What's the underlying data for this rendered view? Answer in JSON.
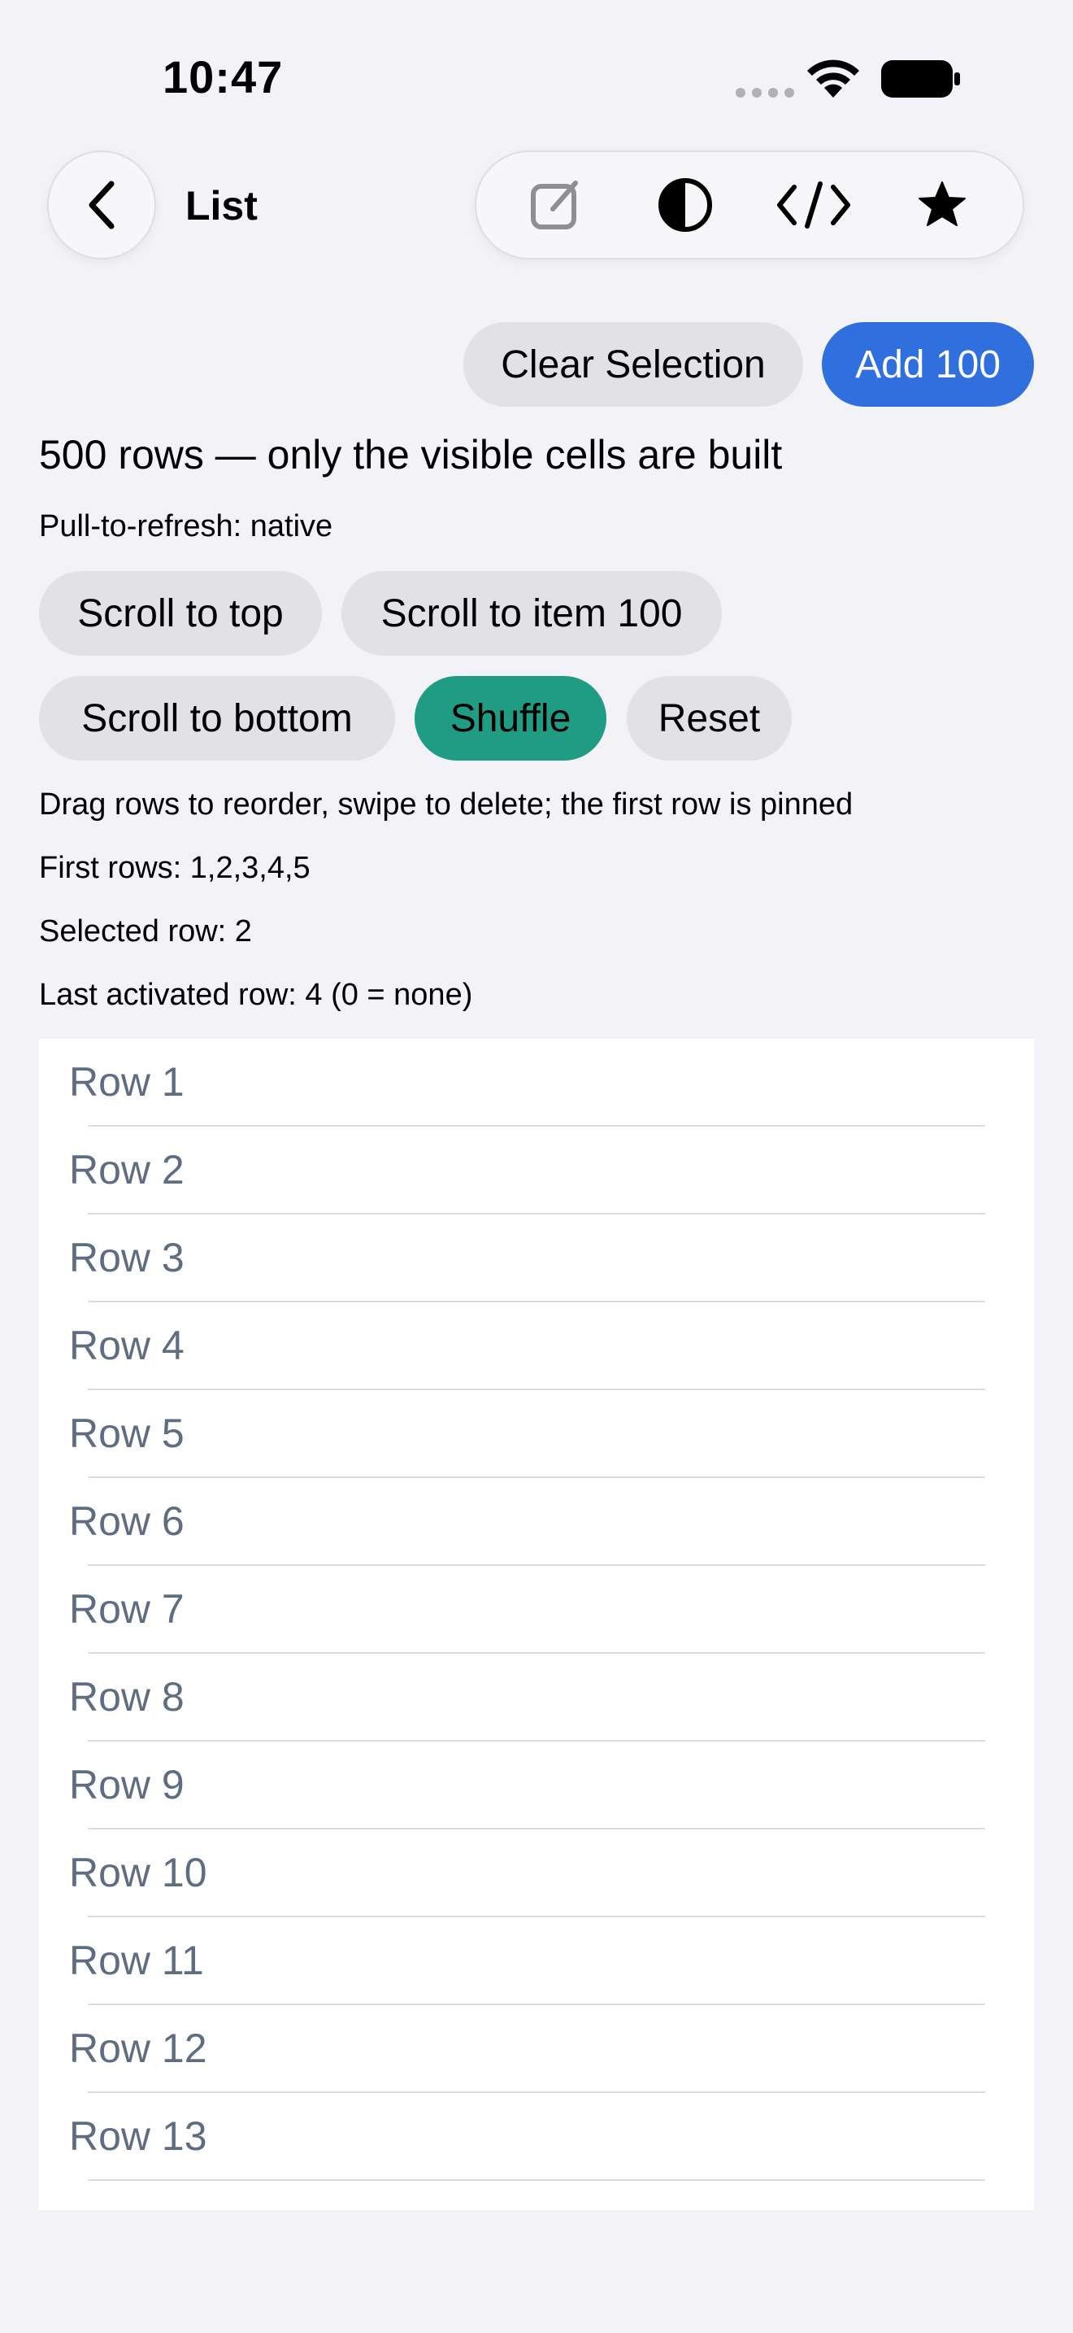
{
  "status": {
    "time": "10:47"
  },
  "nav": {
    "title": "List"
  },
  "toolbar": {
    "icons": [
      "compose-icon",
      "contrast-icon",
      "code-icon",
      "star-icon"
    ]
  },
  "actions": {
    "clear_selection": "Clear Selection",
    "add_100": "Add 100"
  },
  "info": {
    "heading": "500 rows — only the visible cells are built",
    "pull_to_refresh": "Pull-to-refresh: native",
    "drag_hint": "Drag rows to reorder, swipe to delete; the first row is pinned",
    "first_rows": "First rows: 1,2,3,4,5",
    "selected_row": "Selected row: 2",
    "last_activated": "Last activated row: 4 (0 = none)"
  },
  "controls": {
    "scroll_top": "Scroll to top",
    "scroll_item": "Scroll to item 100",
    "scroll_bottom": "Scroll to bottom",
    "shuffle": "Shuffle",
    "reset": "Reset"
  },
  "colors": {
    "accent_blue": "#2f6fde",
    "accent_teal": "#1f9c83",
    "row_text": "#5f6d80",
    "background": "#f2f2f7"
  },
  "rows": [
    "Row 1",
    "Row 2",
    "Row 3",
    "Row 4",
    "Row 5",
    "Row 6",
    "Row 7",
    "Row 8",
    "Row 9",
    "Row 10",
    "Row 11",
    "Row 12",
    "Row 13"
  ]
}
